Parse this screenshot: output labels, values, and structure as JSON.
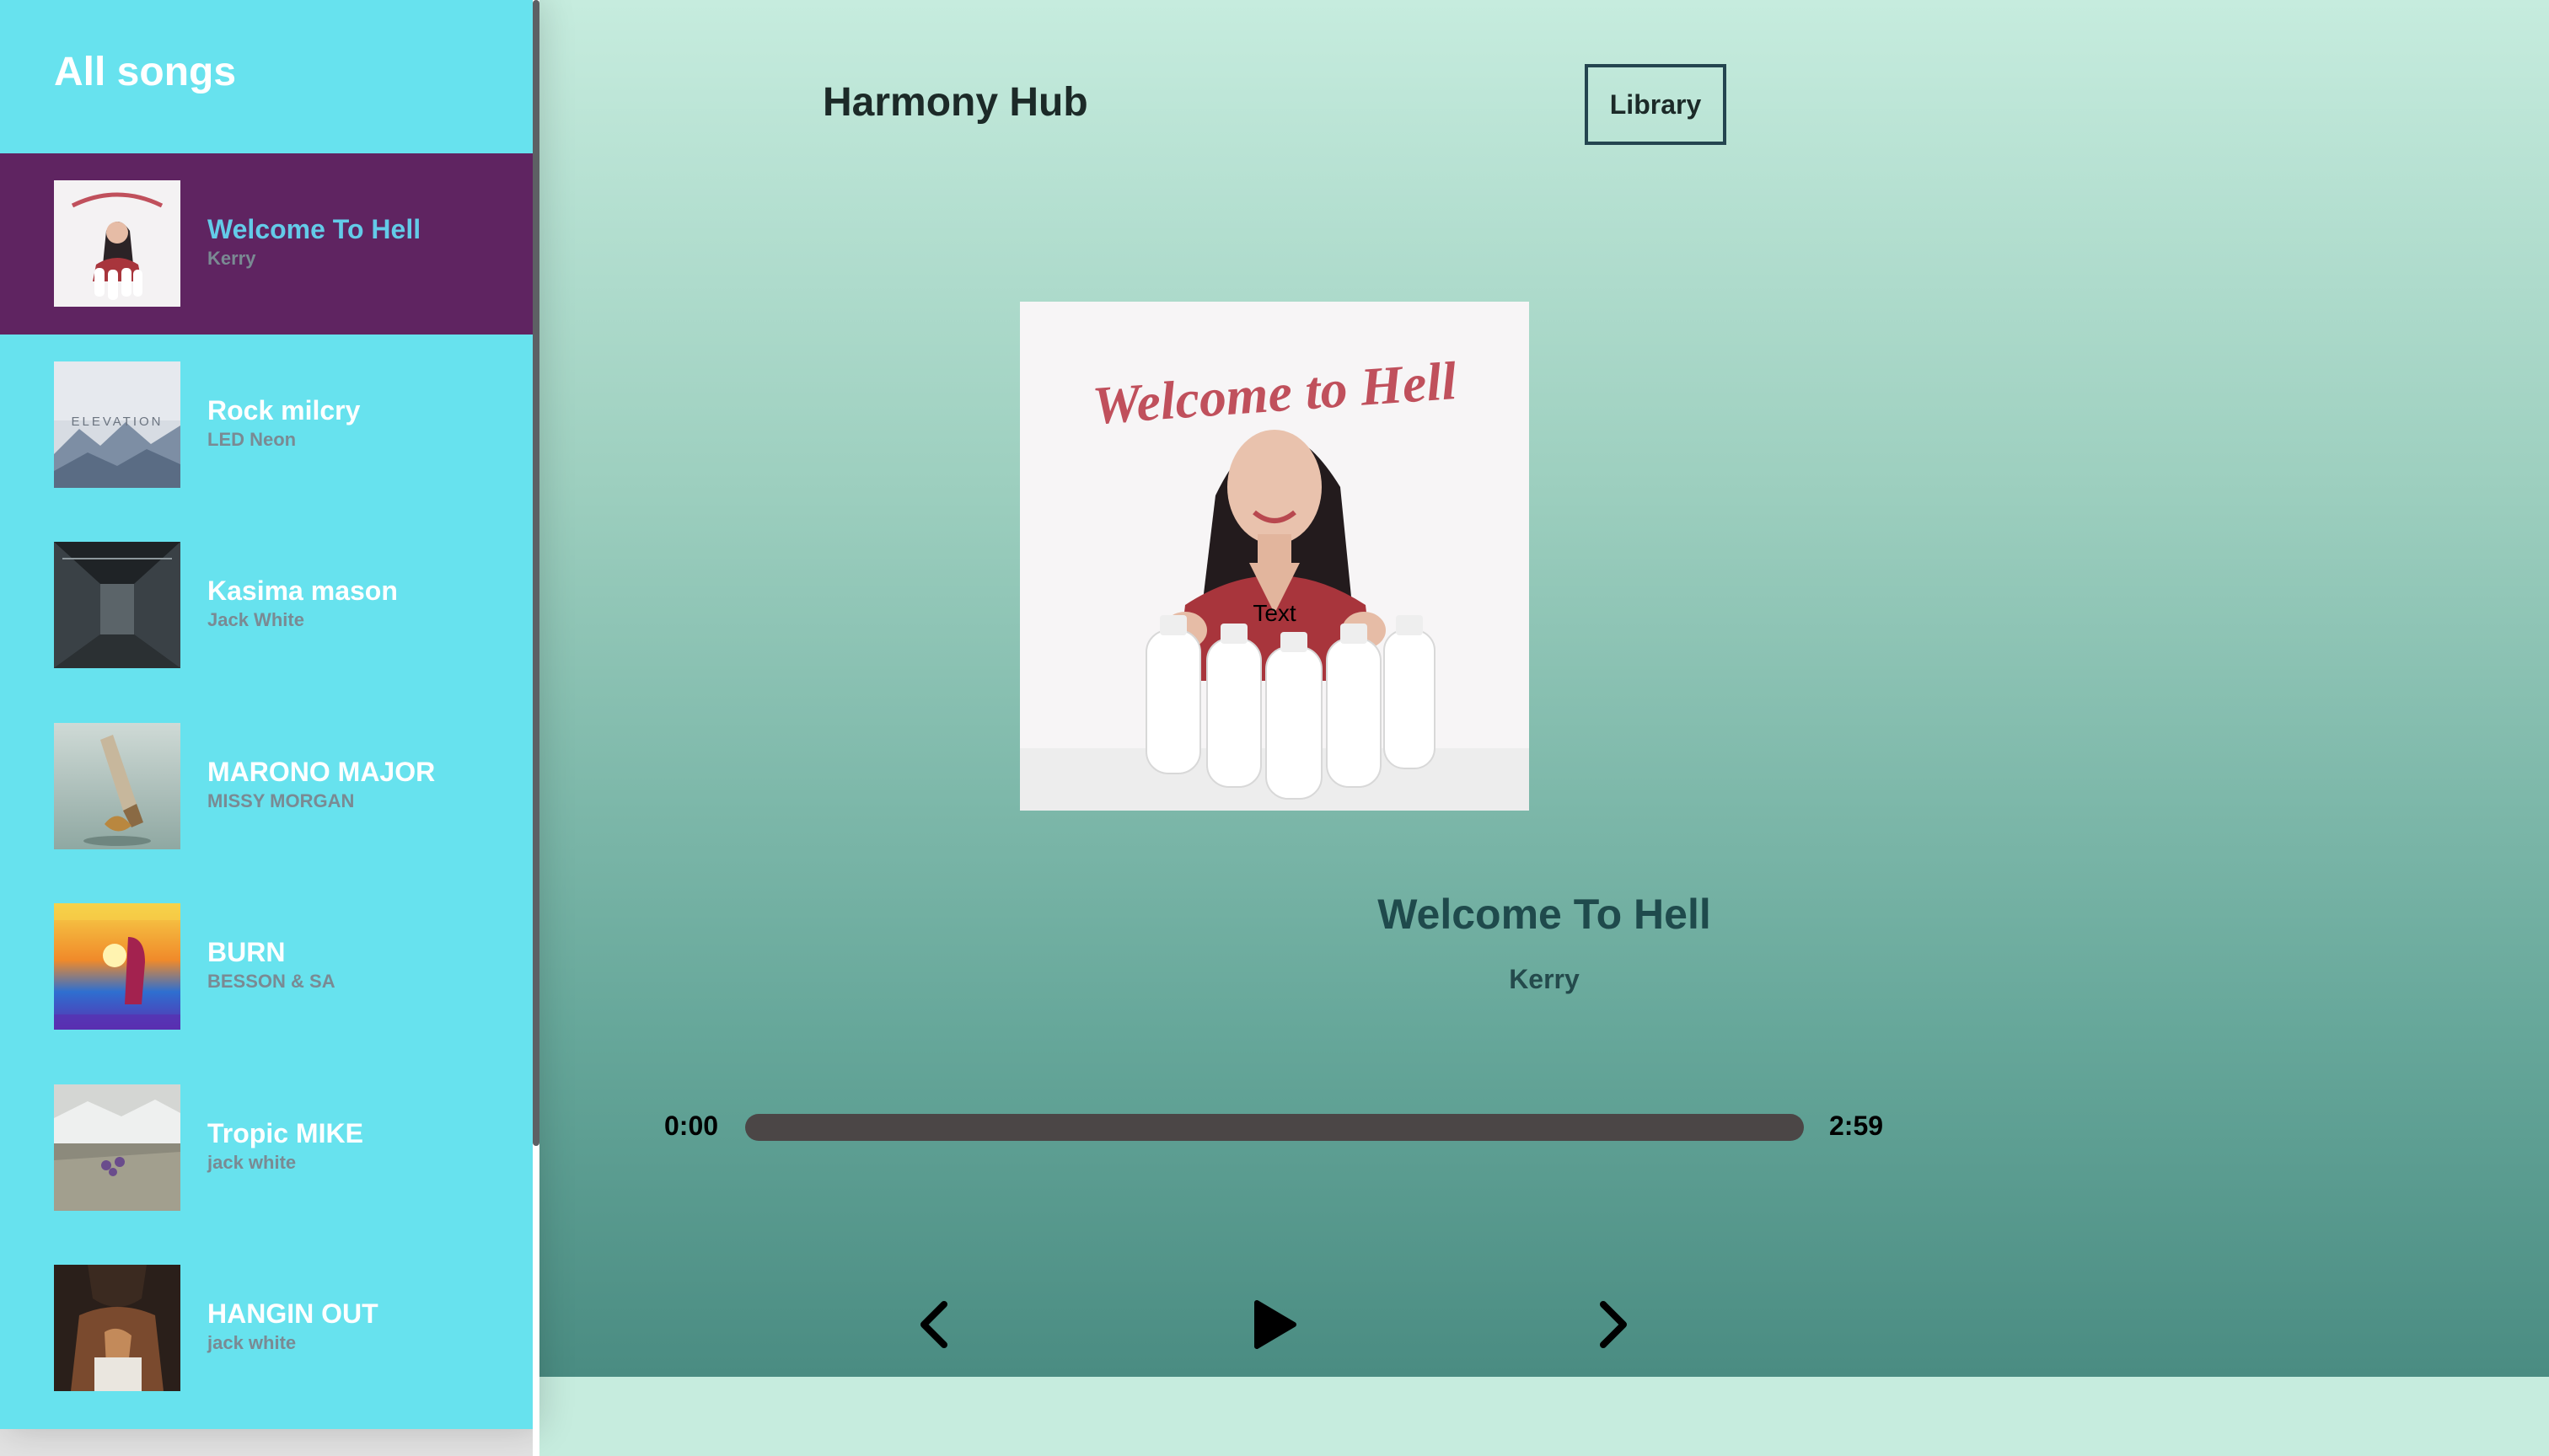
{
  "sidebar": {
    "title": "All songs",
    "songs": [
      {
        "name": "Welcome To Hell",
        "artist": "Kerry",
        "active": true
      },
      {
        "name": "Rock milcry",
        "artist": "LED Neon",
        "cover_text": "ELEVATION"
      },
      {
        "name": "Kasima mason",
        "artist": "Jack White"
      },
      {
        "name": "MARONO MAJOR",
        "artist": "MISSY MORGAN"
      },
      {
        "name": "BURN",
        "artist": "BESSON & SA"
      },
      {
        "name": "Tropic MIKE",
        "artist": "jack white"
      },
      {
        "name": "HANGIN OUT",
        "artist": "jack white"
      }
    ]
  },
  "header": {
    "brand": "Harmony Hub",
    "library_label": "Library"
  },
  "player": {
    "art_text": "Welcome to Hell",
    "art_caption": "Text",
    "title": "Welcome To Hell",
    "artist": "Kerry",
    "current_time": "0:00",
    "duration": "2:59",
    "progress_fraction": 0
  },
  "colors": {
    "sidebar_bg": "#67e2ee",
    "active_row": "#5f2461",
    "active_title": "#63cbe8",
    "progress_track": "#4b4646"
  },
  "icons": {
    "prev": "chevron-left-icon",
    "play": "play-icon",
    "next": "chevron-right-icon"
  }
}
